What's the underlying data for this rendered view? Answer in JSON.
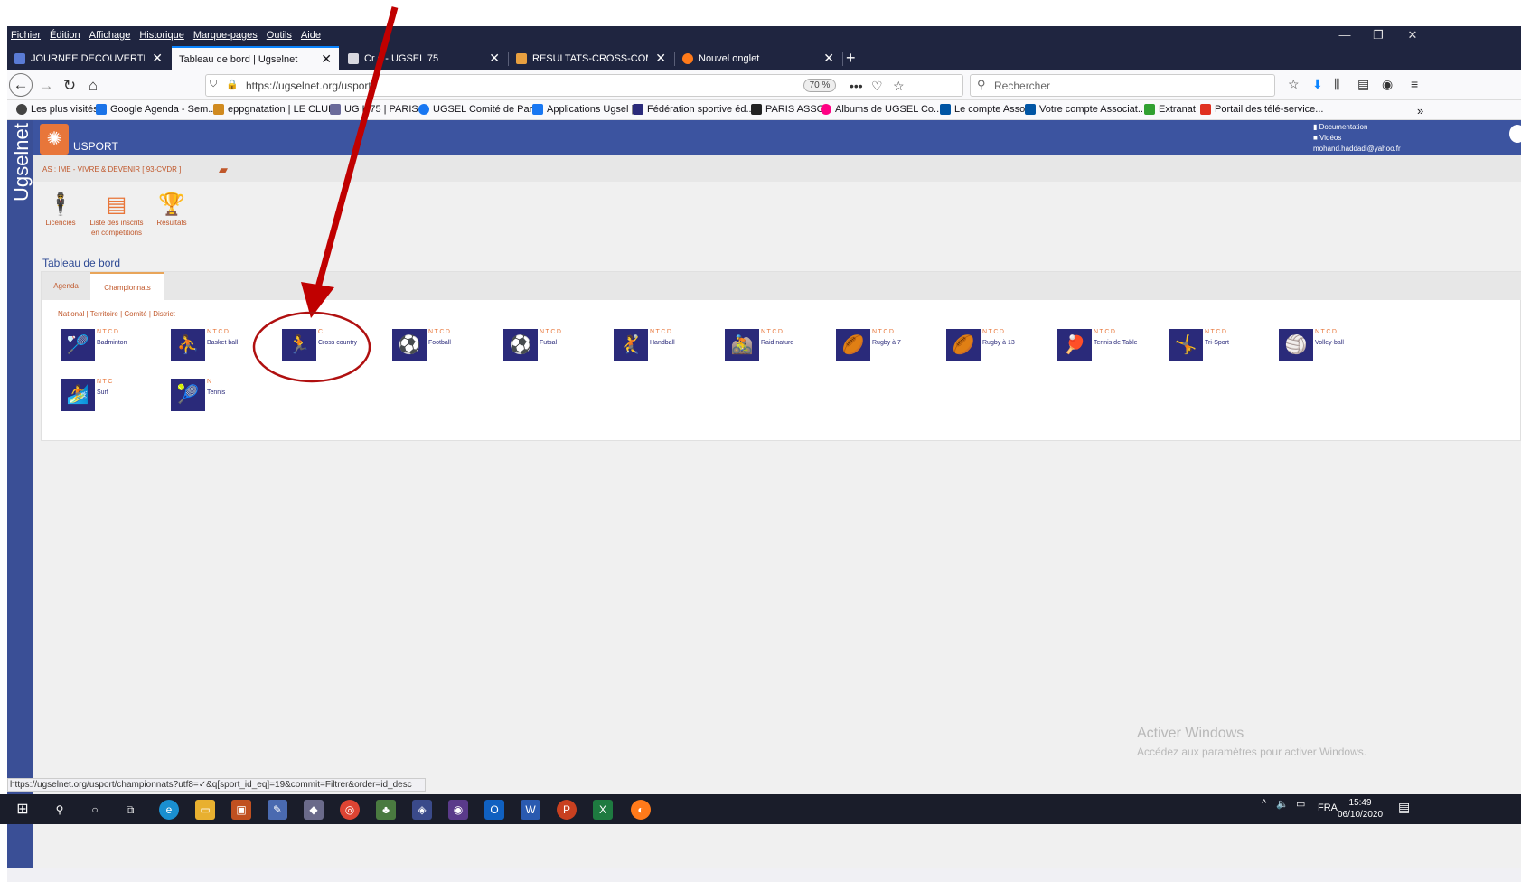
{
  "menubar": {
    "items": [
      "Fichier",
      "Édition",
      "Affichage",
      "Historique",
      "Marque-pages",
      "Outils",
      "Aide"
    ]
  },
  "tabs": [
    {
      "label": "JOURNEE DECOUVERTE SPORTI",
      "color": "#5a7bd5"
    },
    {
      "label": "Tableau de bord | Ugselnet",
      "color": "#ffffff"
    },
    {
      "label": "Cr",
      "label2": "s - UGSEL 75",
      "color": "#ffffff"
    },
    {
      "label": "RESULTATS-CROSS-COMITE-DE",
      "color": "#e8a040"
    },
    {
      "label": "Nouvel onglet",
      "color": "#ff7a1a"
    }
  ],
  "nav": {
    "url": "https://ugselnet.org/usport",
    "zoom": "70 %",
    "search_placeholder": "Rechercher"
  },
  "bookmarks": [
    {
      "label": "Les plus visités",
      "color": "#444444"
    },
    {
      "label": "Google Agenda - Sem...",
      "color": "#1a73e8"
    },
    {
      "label": "eppgnatation | LE CLUB",
      "color": "#d08a20"
    },
    {
      "label": "UG",
      "label2": "L 75 | PARIS",
      "color": "#6a6a9a"
    },
    {
      "label": "UGSEL Comité de Paris",
      "color": "#1877f2"
    },
    {
      "label": "Applications Ugsel |",
      "color": "#1877f2"
    },
    {
      "label": "Fédération sportive éd...",
      "color": "#2a2a7a"
    },
    {
      "label": "PARIS ASSO",
      "color": "#222222"
    },
    {
      "label": "Albums de UGSEL Co...",
      "color": "#ff0084"
    },
    {
      "label": "Le compte Asso",
      "color": "#0055a4"
    },
    {
      "label": "Votre compte Associat...",
      "color": "#0055a4"
    },
    {
      "label": "Extranat",
      "color": "#30a030"
    },
    {
      "label": "Portail des télé-service...",
      "color": "#e03020"
    }
  ],
  "app": {
    "brand": "Ugselnet",
    "name": "USPORT",
    "links": [
      "Documentation",
      "Vidéos"
    ],
    "user_email": "mohand.haddadi@yahoo.fr",
    "association": "AS : IME - VIVRE & DEVENIR [ 93-CVDR ]",
    "top_menu": [
      {
        "label": "Licenciés",
        "label2": "",
        "icon": "person-icon"
      },
      {
        "label": "Liste des inscrits",
        "label2": "en compétitions",
        "icon": "list-icon"
      },
      {
        "label": "Résultats",
        "label2": "",
        "icon": "trophy-icon"
      }
    ],
    "page_title": "Tableau de bord",
    "panel_tabs": [
      "Agenda",
      "Championnats"
    ],
    "filters": "National | Territoire | Comité | District",
    "sports": [
      {
        "levels": "NTCD",
        "name": "Badminton",
        "glyph": "🏸"
      },
      {
        "levels": "NTCD",
        "name": "Basket ball",
        "glyph": "⛹"
      },
      {
        "levels": "C",
        "name": "Cross country",
        "glyph": "🏃"
      },
      {
        "levels": "NTCD",
        "name": "Football",
        "glyph": "⚽"
      },
      {
        "levels": "NTCD",
        "name": "Futsal",
        "glyph": "⚽"
      },
      {
        "levels": "NTCD",
        "name": "Handball",
        "glyph": "🤾"
      },
      {
        "levels": "NTCD",
        "name": "Raid nature",
        "glyph": "🚵"
      },
      {
        "levels": "NTCD",
        "name": "Rugby à 7",
        "glyph": "🏉"
      },
      {
        "levels": "NTCD",
        "name": "Rugby à 13",
        "glyph": "🏉"
      },
      {
        "levels": "NTCD",
        "name": "Tennis de Table",
        "glyph": "🏓"
      },
      {
        "levels": "NTCD",
        "name": "Tri-Sport",
        "glyph": "🤸"
      },
      {
        "levels": "NTCD",
        "name": "Volley-ball",
        "glyph": "🏐"
      },
      {
        "levels": "NTC",
        "name": "Surf",
        "glyph": "🏄"
      },
      {
        "levels": "N",
        "name": "Tennis",
        "glyph": "🎾"
      }
    ]
  },
  "watermark": {
    "line1": "Activer Windows",
    "line2": "Accédez aux paramètres pour activer Windows."
  },
  "status_url": "https://ugselnet.org/usport/championnats?utf8=✓&q[sport_id_eq]=19&commit=Filtrer&order=id_desc",
  "taskbar": {
    "lang": "FRA",
    "time": "15:49",
    "date": "06/10/2020"
  },
  "annotation": {
    "arrow_color": "#c00000",
    "circle_color": "#b01010"
  }
}
